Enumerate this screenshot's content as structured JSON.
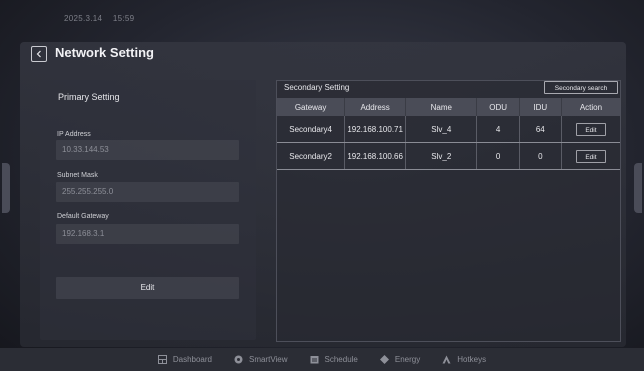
{
  "status_bar": {
    "date": "2025.3.14",
    "time": "15:59"
  },
  "page": {
    "title": "Network Setting"
  },
  "primary": {
    "title": "Primary Setting",
    "ip_label": "IP Address",
    "ip_value": "10.33.144.53",
    "subnet_label": "Subnet Mask",
    "subnet_value": "255.255.255.0",
    "gateway_label": "Default Gateway",
    "gateway_value": "192.168.3.1",
    "edit_label": "Edit"
  },
  "secondary": {
    "title": "Secondary Setting",
    "search_label": "Secondary search",
    "columns": [
      "Gateway",
      "Address",
      "Name",
      "ODU",
      "IDU",
      "Action"
    ],
    "rows": [
      {
        "gateway": "Secondary4",
        "address": "192.168.100.71",
        "name": "Slv_4",
        "odu": "4",
        "idu": "64",
        "action": "Edit"
      },
      {
        "gateway": "Secondary2",
        "address": "192.168.100.66",
        "name": "Slv_2",
        "odu": "0",
        "idu": "0",
        "action": "Edit"
      }
    ]
  },
  "nav": {
    "items": [
      {
        "label": "Dashboard",
        "icon": "dashboard-icon"
      },
      {
        "label": "SmartView",
        "icon": "smartview-icon"
      },
      {
        "label": "Schedule",
        "icon": "schedule-icon"
      },
      {
        "label": "Energy",
        "icon": "energy-icon"
      },
      {
        "label": "Hotkeys",
        "icon": "hotkeys-icon"
      }
    ]
  }
}
